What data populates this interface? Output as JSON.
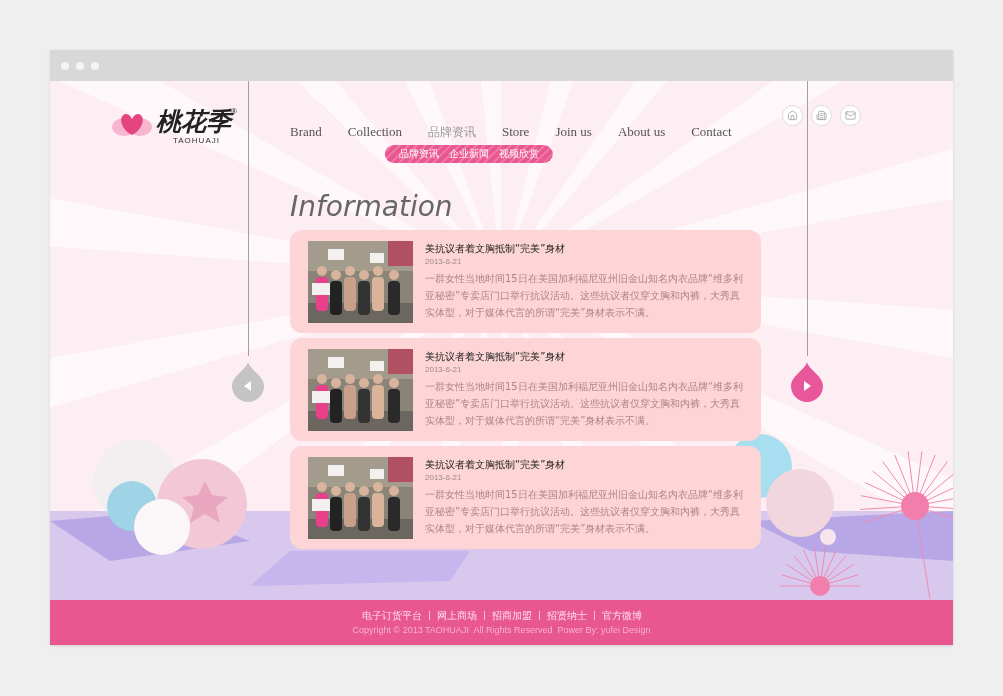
{
  "logo": {
    "name": "桃花季",
    "registered": "®",
    "latin": "TAOHUAJI"
  },
  "nav": [
    {
      "label": "Brand",
      "selected": false
    },
    {
      "label": "Collection",
      "selected": false
    },
    {
      "label": "品牌资讯",
      "selected": true
    },
    {
      "label": "Store",
      "selected": false
    },
    {
      "label": "Join us",
      "selected": false
    },
    {
      "label": "About us",
      "selected": false
    },
    {
      "label": "Contact",
      "selected": false
    }
  ],
  "submenu": [
    "品牌资讯",
    "企业新闻",
    "视频欣赏"
  ],
  "heading": "Information",
  "pager": {
    "prev_disabled": true,
    "next_disabled": false
  },
  "articles": [
    {
      "title": "美抗议者着文胸抵制“完美”身材",
      "date": "2013-6-21",
      "summary": "一群女性当地时间15日在美国加利福尼亚州旧金山知名内衣品牌“维多利亚秘密”专卖店门口举行抗议活动。这些抗议者仅穿文胸和内裤，大秀真实体型，对于媒体代言的所谓“完美”身材表示不满。"
    },
    {
      "title": "美抗议者着文胸抵制“完美”身材",
      "date": "2013-6-21",
      "summary": "一群女性当地时间15日在美国加利福尼亚州旧金山知名内衣品牌“维多利亚秘密”专卖店门口举行抗议活动。这些抗议者仅穿文胸和内裤，大秀真实体型，对于媒体代言的所谓“完美”身材表示不满。"
    },
    {
      "title": "美抗议者着文胸抵制“完美”身材",
      "date": "2013-6-21",
      "summary": "一群女性当地时间15日在美国加利福尼亚州旧金山知名内衣品牌“维多利亚秘密”专卖店门口举行抗议活动。这些抗议者仅穿文胸和内裤，大秀真实体型，对于媒体代言的所谓“完美”身材表示不满。"
    }
  ],
  "footer": {
    "links": [
      "电子订货平台",
      "网上商场",
      "招商加盟",
      "招贤纳士",
      "官方微博"
    ],
    "copyright": "Copyright © 2013 TAOHUAJI  All Rights Reserved  Power By: yufei Design"
  }
}
